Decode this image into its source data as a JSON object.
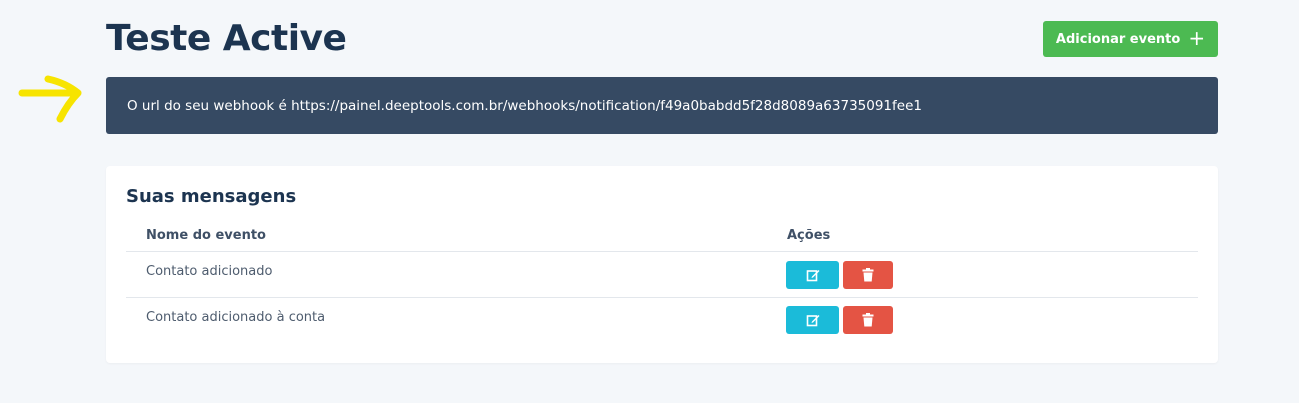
{
  "header": {
    "title": "Teste Active",
    "add_button_label": "Adicionar evento",
    "add_button_icon": "+"
  },
  "banner": {
    "text": "O url do seu webhook é https://painel.deeptools.com.br/webhooks/notification/f49a0babdd5f28d8089a63735091fee1"
  },
  "messages": {
    "title": "Suas mensagens",
    "columns": {
      "name": "Nome do evento",
      "actions": "Ações"
    },
    "rows": [
      {
        "name": "Contato adicionado"
      },
      {
        "name": "Contato adicionado à conta"
      }
    ]
  },
  "colors": {
    "add_button": "#4cba52",
    "banner_bg": "#364a63",
    "edit_button": "#1bbbd9",
    "delete_button": "#e45444",
    "arrow": "#f7e400"
  },
  "icons": {
    "edit": "edit-icon",
    "delete": "trash-icon",
    "annotation": "arrow-icon"
  }
}
